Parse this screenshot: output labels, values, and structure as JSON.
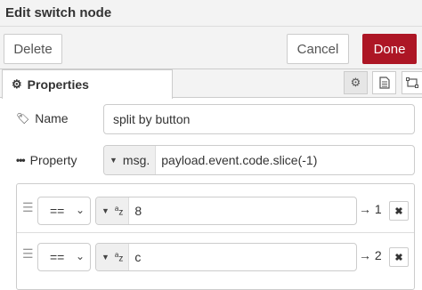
{
  "window": {
    "title": "Edit switch node"
  },
  "actions": {
    "delete_label": "Delete",
    "cancel_label": "Cancel",
    "done_label": "Done"
  },
  "tabs": {
    "properties_label": "Properties"
  },
  "form": {
    "name_label": "Name",
    "name_value": "split by button",
    "property_label": "Property",
    "property_type": "msg.",
    "property_value": "payload.event.code.slice(-1)"
  },
  "rules": [
    {
      "operator": "==",
      "type_icon": "az-string-icon",
      "value": "8",
      "output": "→ 1"
    },
    {
      "operator": "==",
      "type_icon": "az-string-icon",
      "value": "c",
      "output": "→ 2"
    }
  ],
  "colors": {
    "accent": "#ad1625",
    "toolbar_bg": "#f3f3f3",
    "border": "#cccccc"
  }
}
